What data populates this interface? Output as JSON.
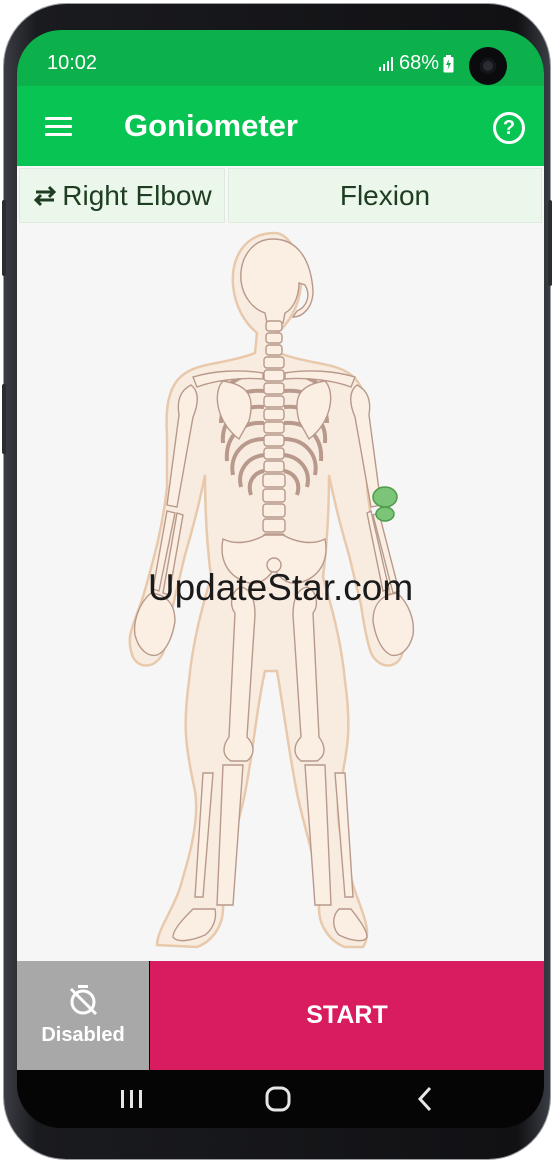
{
  "status_bar": {
    "time": "10:02",
    "battery": "68%"
  },
  "app_bar": {
    "title": "Goniometer"
  },
  "selector": {
    "joint_label": "Right Elbow",
    "motion_label": "Flexion"
  },
  "watermark": "UpdateStar.com",
  "bottom_bar": {
    "timer_label": "Disabled",
    "start_label": "START"
  },
  "colors": {
    "status": "#0db14b",
    "app_bar": "#08c553",
    "start": "#d91b5f",
    "timer": "#a8a8a8",
    "highlight_joint": "#7cc477"
  },
  "icons": [
    "menu-icon",
    "help-icon",
    "swap-icon",
    "timer-off-icon",
    "recents-icon",
    "home-icon",
    "back-icon"
  ]
}
